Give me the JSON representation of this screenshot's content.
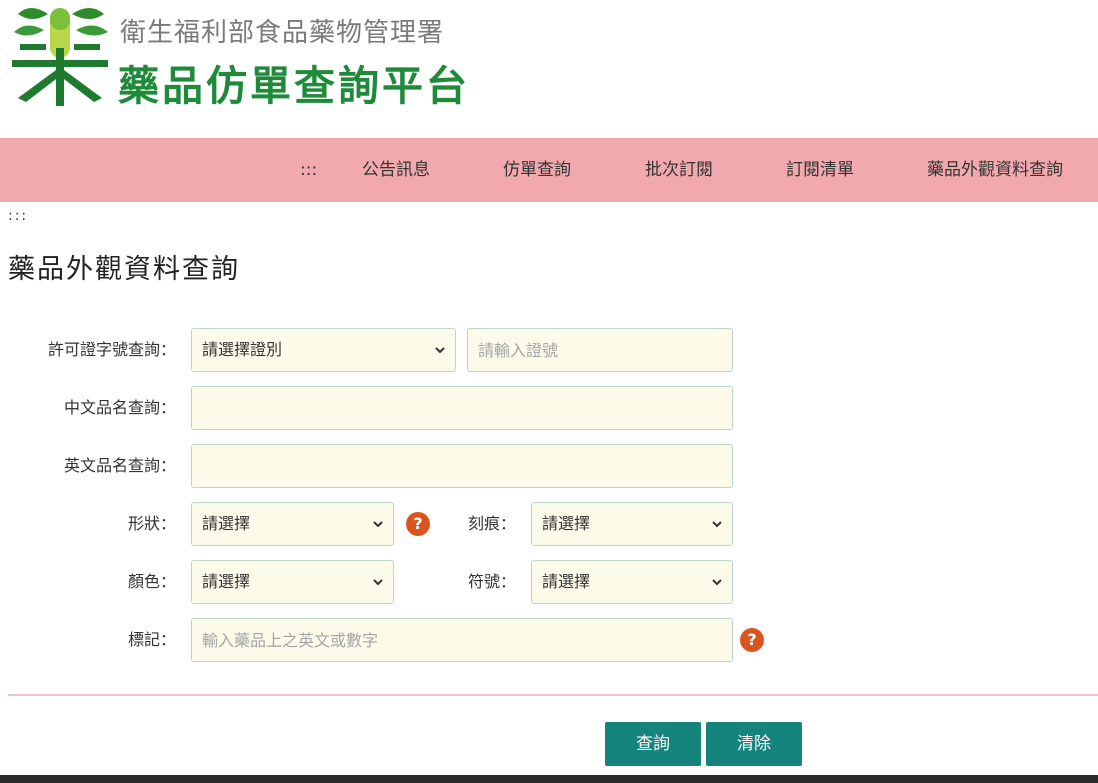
{
  "header": {
    "agency": "衛生福利部食品藥物管理署",
    "platform": "藥品仿單查詢平台"
  },
  "nav": {
    "accesskey": ":::",
    "items": [
      "公告訊息",
      "仿單查詢",
      "批次訂閱",
      "訂閱清單",
      "藥品外觀資料查詢"
    ]
  },
  "breadcrumb": ":::",
  "page_title": "藥品外觀資料查詢",
  "form": {
    "license": {
      "label": "許可證字號查詢：",
      "select_value": "請選擇證別",
      "input_placeholder": "請輸入證號"
    },
    "chinese_name": {
      "label": "中文品名查詢：",
      "value": ""
    },
    "english_name": {
      "label": "英文品名查詢：",
      "value": ""
    },
    "shape": {
      "label": "形狀：",
      "value": "請選擇"
    },
    "score": {
      "label": "刻痕：",
      "value": "請選擇"
    },
    "color": {
      "label": "顏色：",
      "value": "請選擇"
    },
    "symbol": {
      "label": "符號：",
      "value": "請選擇"
    },
    "marking": {
      "label": "標記：",
      "placeholder": "輸入藥品上之英文或數字"
    },
    "help_glyph": "?"
  },
  "buttons": {
    "search": "查詢",
    "clear": "清除"
  },
  "colors": {
    "nav_bg": "#f2a9ae",
    "brand_green": "#1f8a3a",
    "button_teal": "#15847d",
    "help_orange": "#d9541e",
    "field_bg": "#fcfbea"
  }
}
